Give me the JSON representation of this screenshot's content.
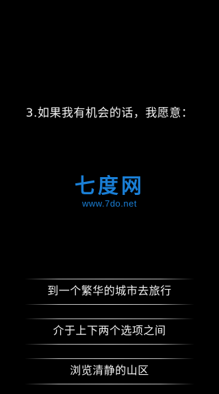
{
  "question": "3.如果我有机会的话，我愿意：",
  "watermark": {
    "logo": "七度网",
    "url": "www.7do.net",
    "color": "#1a7fd6"
  },
  "options": [
    {
      "label": "到一个繁华的城市去旅行"
    },
    {
      "label": "介于上下两个选项之间"
    },
    {
      "label": "浏览清静的山区"
    }
  ]
}
